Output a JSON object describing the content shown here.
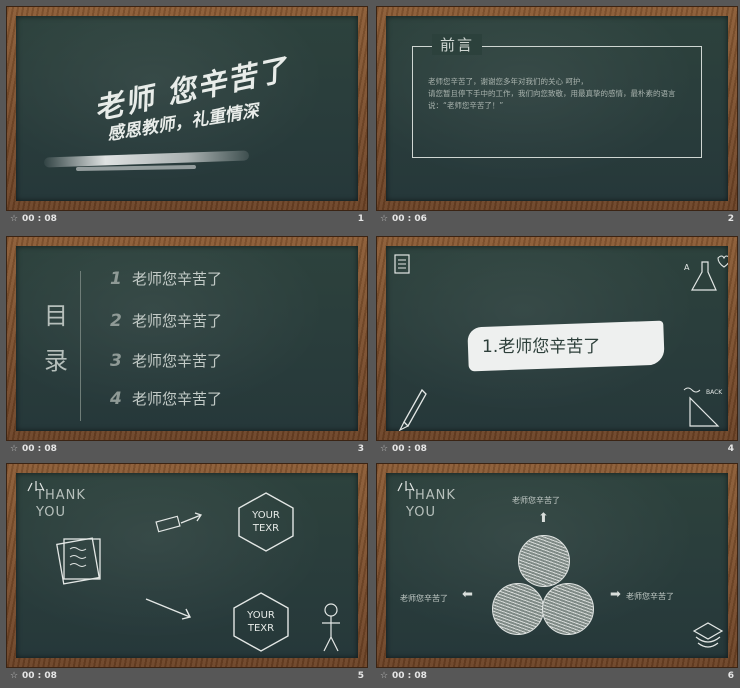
{
  "slides": [
    {
      "number": "1",
      "time": "00 : 08",
      "title": "老师 您辛苦了",
      "subtitle": "感恩教师，礼重情深"
    },
    {
      "number": "2",
      "time": "00 : 06",
      "heading": "前言",
      "body": "老师您辛苦了，谢谢您多年对我们的关心 呵护，\n请您暂且停下手中的工作，我们向您致敬，用最真挚的感情，最朴素的语言说：“老师您辛苦了！”"
    },
    {
      "number": "3",
      "time": "00 : 08",
      "toc_char_1": "目",
      "toc_char_2": "录",
      "items": [
        {
          "num": "1",
          "label": "老师您辛苦了"
        },
        {
          "num": "2",
          "label": "老师您辛苦了"
        },
        {
          "num": "3",
          "label": "老师您辛苦了"
        },
        {
          "num": "4",
          "label": "老师您辛苦了"
        }
      ]
    },
    {
      "number": "4",
      "time": "00 : 08",
      "section": "1.老师您辛苦了"
    },
    {
      "number": "5",
      "time": "00 : 08",
      "thank_1": "THANK",
      "thank_2": "YOU",
      "hex_1_a": "YOUR",
      "hex_1_b": "TEXR",
      "hex_2_a": "YOUR",
      "hex_2_b": "TEXR"
    },
    {
      "number": "6",
      "time": "00 : 08",
      "thank_1": "THANK",
      "thank_2": "YOU",
      "label_top": "老师您辛苦了",
      "label_left": "老师您辛苦了",
      "label_right": "老师您辛苦了"
    }
  ],
  "icons": {
    "star": "☆"
  }
}
